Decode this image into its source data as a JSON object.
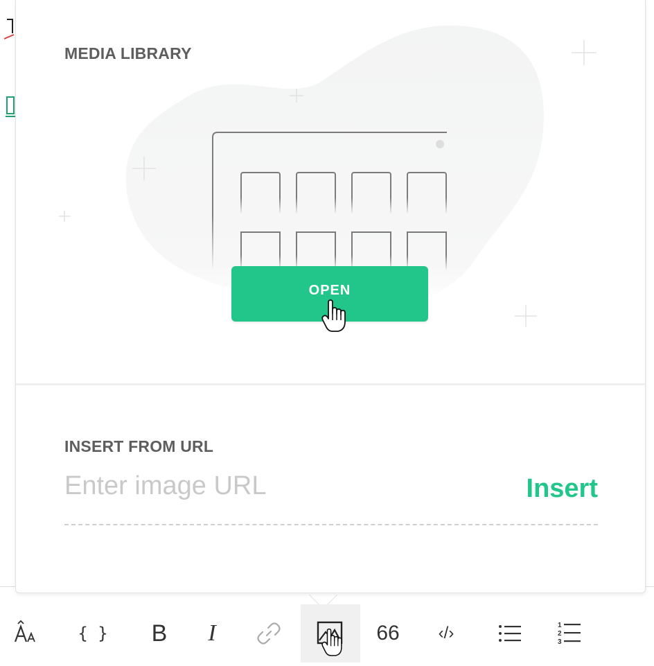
{
  "media_library": {
    "title": "MEDIA LIBRARY",
    "open_label": "OPEN"
  },
  "insert_from_url": {
    "title": "INSERT FROM URL",
    "placeholder": "Enter image URL",
    "value": "",
    "insert_label": "Insert"
  },
  "toolbar": {
    "items": [
      {
        "name": "text-size-icon",
        "text": ""
      },
      {
        "name": "code-block-icon",
        "text": "{ }"
      },
      {
        "name": "bold-icon",
        "text": "B"
      },
      {
        "name": "italic-icon",
        "text": "I"
      },
      {
        "name": "link-icon",
        "text": ""
      },
      {
        "name": "image-icon",
        "text": "",
        "active": true
      },
      {
        "name": "quote-icon",
        "text": "66"
      },
      {
        "name": "inline-code-icon",
        "text": "‹/›"
      },
      {
        "name": "bullet-list-icon",
        "text": ""
      },
      {
        "name": "numbered-list-icon",
        "text": ""
      }
    ]
  },
  "colors": {
    "accent": "#22c68a",
    "title_text": "#5e5e5e",
    "placeholder": "#c9c9c9"
  }
}
